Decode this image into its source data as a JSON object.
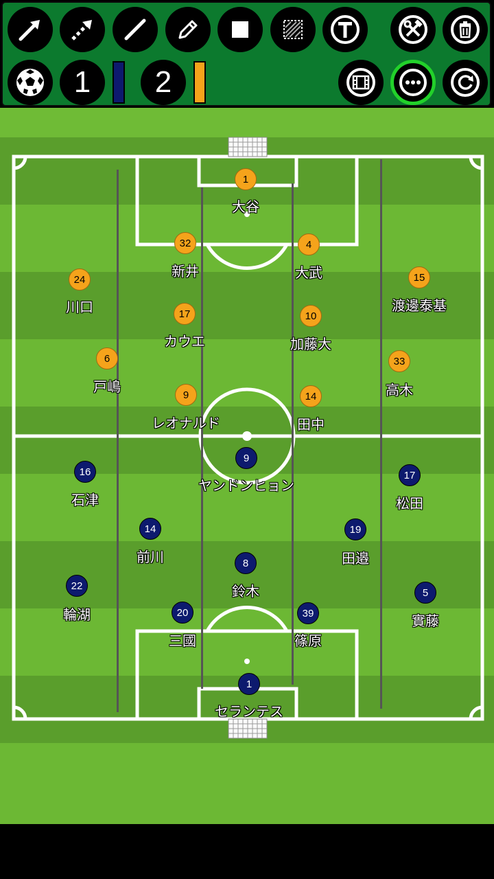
{
  "toolbar": {
    "tools": [
      "arrow-tool",
      "dashed-arrow-tool",
      "line-tool",
      "pencil-tool",
      "rectangle-tool",
      "area-select-tool",
      "text-tool",
      "tools-menu",
      "delete"
    ],
    "team1": {
      "label": "1",
      "color": "#0d1a6e"
    },
    "team2": {
      "label": "2",
      "color": "#f5a31b"
    },
    "accent": "#22d12a"
  },
  "teams": {
    "home": {
      "color": "#f5a31b",
      "players": [
        {
          "number": "1",
          "name": "大谷"
        },
        {
          "number": "32",
          "name": "新井"
        },
        {
          "number": "4",
          "name": "大武"
        },
        {
          "number": "24",
          "name": "川口"
        },
        {
          "number": "15",
          "name": "渡邊泰基"
        },
        {
          "number": "17",
          "name": "カウエ"
        },
        {
          "number": "10",
          "name": "加藤大"
        },
        {
          "number": "6",
          "name": "戸嶋"
        },
        {
          "number": "33",
          "name": "高木"
        },
        {
          "number": "9",
          "name": "レオナルド"
        },
        {
          "number": "14",
          "name": "田中"
        }
      ]
    },
    "away": {
      "color": "#0d1a6e",
      "players": [
        {
          "number": "9",
          "name": "ヤンドンヒョン"
        },
        {
          "number": "16",
          "name": "石津"
        },
        {
          "number": "17",
          "name": "松田"
        },
        {
          "number": "14",
          "name": "前川"
        },
        {
          "number": "19",
          "name": "田邉"
        },
        {
          "number": "8",
          "name": "鈴木"
        },
        {
          "number": "22",
          "name": "輪湖"
        },
        {
          "number": "5",
          "name": "實藤"
        },
        {
          "number": "20",
          "name": "三國"
        },
        {
          "number": "39",
          "name": "篠原"
        },
        {
          "number": "1",
          "name": "セランテス"
        }
      ]
    }
  }
}
